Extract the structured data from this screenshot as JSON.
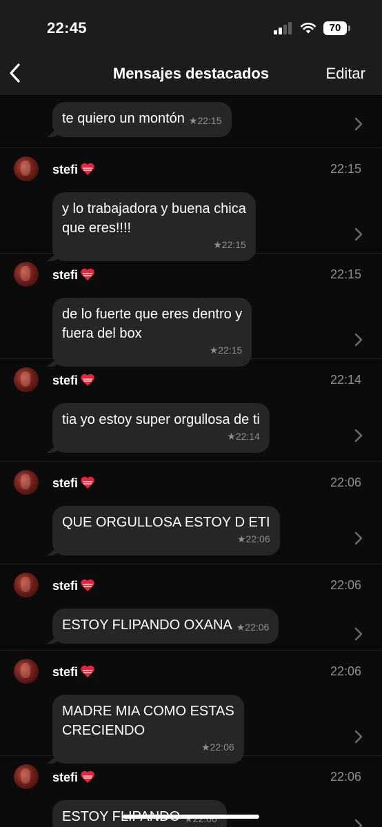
{
  "status_bar": {
    "time": "22:45",
    "battery": "70"
  },
  "nav": {
    "back_icon": "chevron-left-icon",
    "title": "Mensajes destacados",
    "edit_label": "Editar"
  },
  "colors": {
    "background": "#0b0b0c",
    "header": "#1c1c1e",
    "bubble": "#262628",
    "secondary_text": "#8e8e93"
  },
  "messages": [
    {
      "sender": "",
      "time": "",
      "text": "te quiero un montón",
      "stamp": "★22:15"
    },
    {
      "sender": "stefi",
      "time": "22:15",
      "text": "y lo trabajadora y buena chica\nque eres!!!!",
      "stamp": "★22:15"
    },
    {
      "sender": "stefi",
      "time": "22:15",
      "text": "de lo fuerte que eres dentro y\nfuera del box",
      "stamp": "★22:15"
    },
    {
      "sender": "stefi",
      "time": "22:14",
      "text": "tia yo estoy super orgullosa de ti",
      "stamp": "★22:14"
    },
    {
      "sender": "stefi",
      "time": "22:06",
      "text": "QUE ORGULLOSA ESTOY D ETI",
      "stamp": "★22:06"
    },
    {
      "sender": "stefi",
      "time": "22:06",
      "text": "ESTOY FLIPANDO OXANA",
      "stamp": "★22:06"
    },
    {
      "sender": "stefi",
      "time": "22:06",
      "text": "MADRE MIA COMO ESTAS\nCRECIENDO",
      "stamp": "★22:06"
    },
    {
      "sender": "stefi",
      "time": "22:06",
      "text": "ESTOY FLIPANDO",
      "stamp": "★22:06"
    }
  ]
}
